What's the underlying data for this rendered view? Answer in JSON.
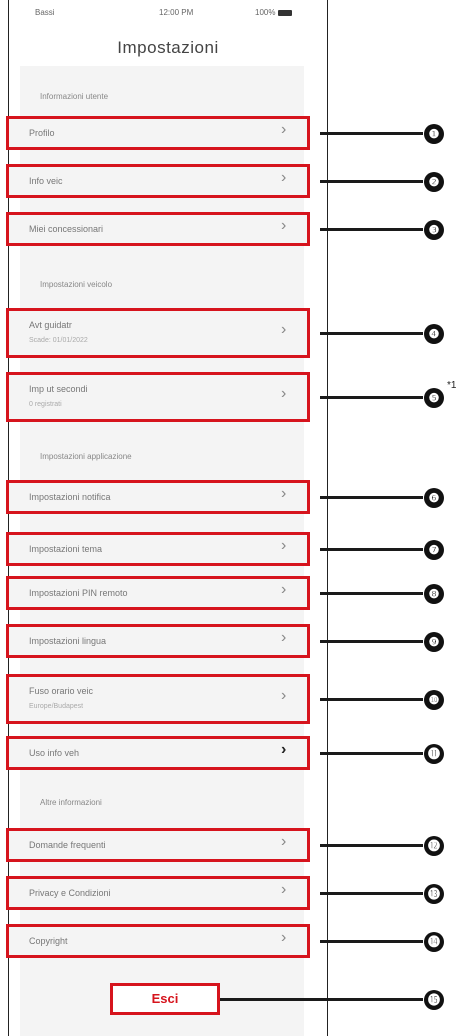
{
  "status_bar": {
    "carrier": "Bassi",
    "time": "12:00 PM",
    "battery": "100%"
  },
  "title": "Impostazioni",
  "sections": {
    "personal": "Informazioni utente",
    "vehicle": "Impostazioni veicolo",
    "app": "Impostazioni applicazione",
    "more": "Altre informazioni"
  },
  "rows": [
    {
      "label": "Profilo",
      "sub": ""
    },
    {
      "label": "Info veic",
      "sub": ""
    },
    {
      "label": "Miei concessionari",
      "sub": ""
    },
    {
      "label": "Avt guidatr",
      "sub": "Scade: 01/01/2022"
    },
    {
      "label": "Imp ut secondi",
      "sub": "0 registrati"
    },
    {
      "label": "Impostazioni notifica",
      "sub": ""
    },
    {
      "label": "Impostazioni tema",
      "sub": ""
    },
    {
      "label": "Impostazioni PIN remoto",
      "sub": ""
    },
    {
      "label": "Impostazioni lingua",
      "sub": ""
    },
    {
      "label": "Fuso orario veic",
      "sub": "Europe/Budapest"
    },
    {
      "label": "Uso info veh",
      "sub": ""
    },
    {
      "label": "Domande frequenti",
      "sub": ""
    },
    {
      "label": "Privacy e Condizioni",
      "sub": ""
    },
    {
      "label": "Copyright",
      "sub": ""
    }
  ],
  "logout_label": "Esci",
  "callouts": [
    "❶",
    "❷",
    "❸",
    "❹",
    "❺",
    "❻",
    "❼",
    "❽",
    "❾",
    "❿",
    "⓫",
    "⓬",
    "⓭",
    "⓮",
    "⓯"
  ],
  "footnote": "*1"
}
